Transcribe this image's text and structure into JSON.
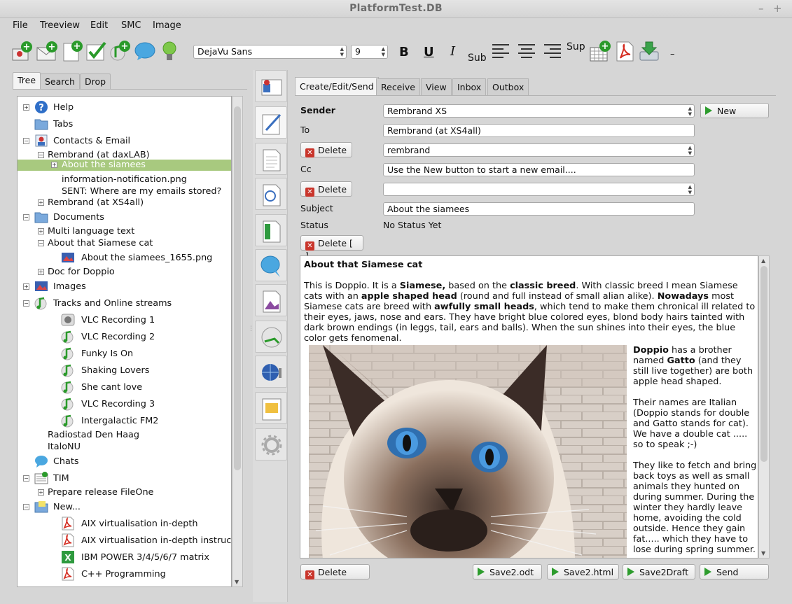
{
  "window": {
    "title": "PlatformTest.DB",
    "minimize": "–",
    "maximize": "+"
  },
  "menu": [
    "File",
    "Treeview",
    "Edit",
    "SMC",
    "Image"
  ],
  "toolbar": {
    "font": "DejaVu Sans",
    "size": "9",
    "bold": "B",
    "underline": "U",
    "italic": "I",
    "sub": "Sub",
    "sup": "Sup",
    "dash": "–",
    "icons": [
      "new-contact-icon",
      "new-email-icon",
      "new-document-icon",
      "new-task-icon",
      "new-track-icon",
      "chat-bubble-icon",
      "lightbulb-icon",
      "align-left-icon",
      "align-center-icon",
      "align-right-icon",
      "insert-table-icon",
      "pdf-icon",
      "download-icon"
    ]
  },
  "left_tabs": [
    "Tree",
    "Search",
    "Drop"
  ],
  "tree": [
    {
      "label": "Help",
      "icon": "help-icon",
      "exp": "+",
      "indent": 0
    },
    {
      "label": "Tabs",
      "icon": "folder-icon",
      "exp": "",
      "indent": 0
    },
    {
      "label": "Contacts & Email",
      "icon": "contacts-icon",
      "exp": "-",
      "indent": 0
    },
    {
      "label": "Rembrand (at daxLAB)",
      "icon": "",
      "exp": "-",
      "indent": 1
    },
    {
      "label": "About the siamees",
      "icon": "",
      "exp": "+",
      "indent": 2,
      "selected": true
    },
    {
      "label": "information-notification.png",
      "icon": "",
      "exp": "",
      "indent": 2
    },
    {
      "label": "SENT: Where are my emails stored?",
      "icon": "",
      "exp": "",
      "indent": 2
    },
    {
      "label": "Rembrand (at XS4all)",
      "icon": "",
      "exp": "+",
      "indent": 1
    },
    {
      "label": "Documents",
      "icon": "folder-icon",
      "exp": "-",
      "indent": 0
    },
    {
      "label": "Multi language text",
      "icon": "",
      "exp": "+",
      "indent": 1
    },
    {
      "label": "About that Siamese cat",
      "icon": "",
      "exp": "-",
      "indent": 1
    },
    {
      "label": "About the siamees_1655.png",
      "icon": "image-icon",
      "exp": "",
      "indent": 3
    },
    {
      "label": "Doc for Doppio",
      "icon": "",
      "exp": "+",
      "indent": 1
    },
    {
      "label": "Images",
      "icon": "images-icon",
      "exp": "+",
      "indent": 0
    },
    {
      "label": "Tracks and Online streams",
      "icon": "music-icon",
      "exp": "-",
      "indent": 0
    },
    {
      "label": "VLC Recording 1",
      "icon": "recording-icon",
      "exp": "",
      "indent": 3
    },
    {
      "label": "VLC Recording 2",
      "icon": "music-icon",
      "exp": "",
      "indent": 3
    },
    {
      "label": "Funky Is On",
      "icon": "music-icon",
      "exp": "",
      "indent": 3
    },
    {
      "label": "Shaking Lovers",
      "icon": "music-icon",
      "exp": "",
      "indent": 3
    },
    {
      "label": "She cant love",
      "icon": "music-icon",
      "exp": "",
      "indent": 3
    },
    {
      "label": "VLC Recording 3",
      "icon": "music-icon",
      "exp": "",
      "indent": 3
    },
    {
      "label": "Intergalactic FM2",
      "icon": "music-icon",
      "exp": "",
      "indent": 3
    },
    {
      "label": "Radiostad Den Haag",
      "icon": "",
      "exp": "",
      "indent": 1
    },
    {
      "label": "ItaloNU",
      "icon": "",
      "exp": "",
      "indent": 1
    },
    {
      "label": "Chats",
      "icon": "chat-icon",
      "exp": "",
      "indent": 0
    },
    {
      "label": "TIM",
      "icon": "tim-icon",
      "exp": "-",
      "indent": 0
    },
    {
      "label": "Prepare release FileOne",
      "icon": "",
      "exp": "+",
      "indent": 1
    },
    {
      "label": "New...",
      "icon": "folder-open-icon",
      "exp": "-",
      "indent": 0
    },
    {
      "label": "AIX virtualisation in-depth",
      "icon": "pdf-icon",
      "exp": "",
      "indent": 3
    },
    {
      "label": "AIX virtualisation in-depth instructor...",
      "icon": "pdf-icon",
      "exp": "",
      "indent": 3
    },
    {
      "label": "IBM POWER 3/4/5/6/7 matrix",
      "icon": "spreadsheet-icon",
      "exp": "",
      "indent": 3
    },
    {
      "label": "C++ Programming",
      "icon": "pdf-icon",
      "exp": "",
      "indent": 3
    }
  ],
  "side_buttons": [
    "contact-card-icon",
    "edit-email-icon",
    "document-icon",
    "search-document-icon",
    "spreadsheet-icon",
    "chat-icon",
    "image-file-icon",
    "music-icon",
    "web-icon",
    "presentation-icon",
    "settings-icon"
  ],
  "right_tabs": [
    "Create/Edit/Send",
    "Receive",
    "View",
    "Inbox",
    "Outbox"
  ],
  "form": {
    "sender_label": "Sender",
    "sender_value": "Rembrand XS",
    "new_btn": "New",
    "to_label": "To",
    "to_value": "Rembrand (at XS4all)",
    "delete1": "Delete",
    "to_select": "rembrand",
    "cc_label": "Cc",
    "cc_value": "Use the New button to start a new email....",
    "delete2": "Delete",
    "cc_select": "",
    "subject_label": "Subject",
    "subject_value": "About the siamees",
    "status_label": "Status",
    "status_value": "No Status Yet",
    "delete_attach": "Delete [ ]"
  },
  "body": {
    "heading": "About that Siamese cat",
    "p1_a": "This is Doppio. It is a ",
    "p1_b": "Siamese,",
    "p1_c": " based on the ",
    "p1_d": "classic breed",
    "p1_e": ". With classic breed I mean Siamese cats with an  ",
    "p1_f": "apple shaped head",
    "p1_g": " (round and full instead of small alian alike). ",
    "p1_h": "Nowadays",
    "p1_i": " most Siamese cats are breed with ",
    "p1_j": "awfully small heads",
    "p1_k": ", which tend to make them chronical ill related to their eyes, jaws, nose and ears.  They have bright blue colored eyes, blond body hairs tainted with dark brown endings (in leggs, tail, ears and balls). When the sun shines into their eyes, the blue color gets fenomenal.",
    "r1_a": "Doppio",
    "r1_b": " has a brother named ",
    "r1_c": "Gatto",
    "r1_d": " (and they still live together) are both apple head shaped.",
    "r2": "Their names are Italian (Doppio stands for double and Gatto stands for cat). We have a double cat ..... so to speak ;-)",
    "r3": "They like to fetch and bring back toys as well as small animals they hunted on during summer. During the winter they hardly leave home, avoiding the cold outside. Hence they gain fat..... which they have to lose during spring summer."
  },
  "bottom": {
    "delete": "Delete",
    "odt": "Save2.odt",
    "html": "Save2.html",
    "draft": "Save2Draft",
    "send": "Send"
  },
  "colors": {
    "selection": "#a8c97f",
    "accent_green": "#2d9c2d",
    "delete_red": "#c9352b"
  }
}
